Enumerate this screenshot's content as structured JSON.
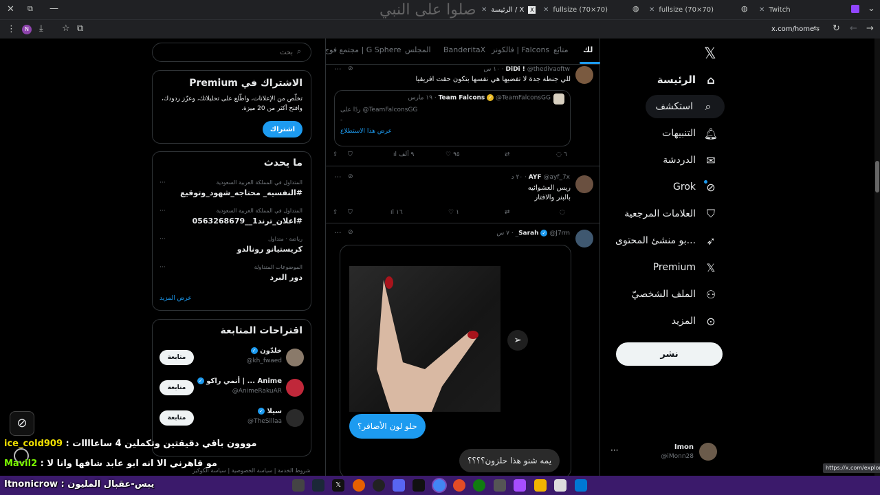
{
  "browser": {
    "tabs": [
      {
        "label": "الرئيسة / X",
        "active": true
      },
      {
        "label": "fullsize (70×70)",
        "active": false
      },
      {
        "label": "fullsize (70×70)",
        "active": false
      },
      {
        "label": "Twitch",
        "active": false
      }
    ],
    "url": "x.com/home",
    "profile_letter": "N",
    "watermark": "صلوا على النبي",
    "status_url": "https://x.com/explore"
  },
  "nav": {
    "items": [
      {
        "label": "الرئيسة",
        "icon": "home-icon"
      },
      {
        "label": "استكشف",
        "icon": "search-icon"
      },
      {
        "label": "التنبيهات",
        "icon": "bell-icon"
      },
      {
        "label": "الدردشة",
        "icon": "mail-icon"
      },
      {
        "label": "Grok",
        "icon": "grok-icon"
      },
      {
        "label": "العلامات المرجعية",
        "icon": "bookmark-icon"
      },
      {
        "label": "...بو منشئ المحتوى",
        "icon": "rocket-icon"
      },
      {
        "label": "Premium",
        "icon": "x-logo-icon"
      },
      {
        "label": "الملف الشخصيّ",
        "icon": "person-icon"
      },
      {
        "label": "المزيد",
        "icon": "more-circle-icon"
      }
    ],
    "post_label": "نشر",
    "account": {
      "name": "Imon",
      "handle": "@iMonn28"
    }
  },
  "top_tabs": [
    "لك",
    "متابَع",
    "فالكونز | Falcons",
    "BanderitaX",
    "المجلس",
    "مجتمع فوج | G Sphere"
  ],
  "tweets": [
    {
      "name": "DiDi !",
      "handle": "@thedivaoftw",
      "time": "١٠ س",
      "text": "للي جنطة جدة لا تفضيها هي نفسها بتكون حقت افريقيا",
      "quote": {
        "name": "Team Falcons",
        "handle": "@TeamFalconsGG",
        "time": "١٩ مارس",
        "reply_to": "ردًا على @TeamFalconsGG",
        "dash": "-",
        "link": "عرض هذا الاستطلاع"
      },
      "stats": {
        "replies": "٦",
        "reposts": "",
        "likes": "٩٥",
        "views": "٩ آلف"
      }
    },
    {
      "name": "AYF",
      "handle": "@ayf_7x",
      "time": "٢٠ د",
      "text_lines": [
        "ريس العشوائيه",
        "بالبنر والافتار"
      ],
      "stats": {
        "replies": "",
        "reposts": "",
        "likes": "١",
        "views": "١٦"
      }
    },
    {
      "name": "Sarah",
      "handle": "@J7rm_",
      "time": "٧ س",
      "bubble_blue": "حلو لون الأضافر؟",
      "bubble_gray": "يمه شنو هذا حلزون؟؟؟؟"
    }
  ],
  "search": {
    "placeholder": "بحث"
  },
  "premium": {
    "title": "الاشتراك في Premium",
    "body": "تخلّص من الإعلانات، واطّلع على تحليلاتك، وعزّز ردودك، وافتح أكثر من 20 ميزة.",
    "button": "اشتراك"
  },
  "trends": {
    "title": "ما يحدث",
    "items": [
      {
        "cat": "المتداول في المملكة العربية السعودية",
        "name": "#النفسيه_ محتاجه_شهود_وتوقيع"
      },
      {
        "cat": "المتداول في المملكة العربية السعودية",
        "name": "#اعلان_ترند1__0563268679"
      },
      {
        "cat": "رياضة · متداول",
        "name": "كريستيانو رونالدو"
      },
      {
        "cat": "الموضوعات المتداولة",
        "name": "دور البرد"
      }
    ],
    "more": "عرض المزيد"
  },
  "follow": {
    "title": "اقتراحات المتابعة",
    "button": "متابعة",
    "users": [
      {
        "name": "خلدّون",
        "handle": "@kh_fwaed"
      },
      {
        "name": "Anime ... | أنمي راكو",
        "handle": "@AnimeRakuAR"
      },
      {
        "name": "سيلا",
        "handle": "@TheSillaa"
      }
    ]
  },
  "footer_links": [
    "شروط الخدمة",
    "سياسة الخصوصية",
    "سياسة الكوكيز"
  ],
  "chat": [
    {
      "user": "ice_cold909",
      "msg": "مووون باقي دقيقتين وتكملين 4 ساعاااات",
      "color": "#f0e000"
    },
    {
      "user": "Mavil2",
      "msg": "مو قاهرني الا انه ابو عابد شافها وانا لا",
      "color": "#7cfc00"
    },
    {
      "user": "Itnonicrow",
      "msg": "يبس-عقبال المليون",
      "color": "#ffffff"
    }
  ],
  "colors": {
    "accent": "#1d9bf0",
    "bg": "#000000",
    "taskbar": "#3b1a6b"
  }
}
